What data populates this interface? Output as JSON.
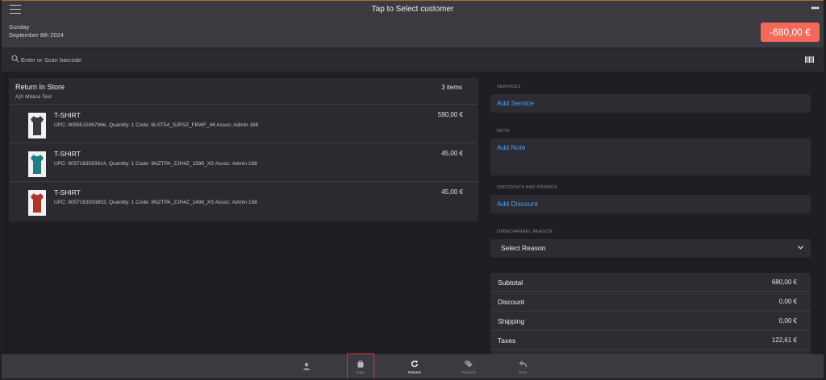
{
  "header": {
    "title": "Tap to Select customer",
    "day": "Sunday",
    "date": "September 8th 2024",
    "total": "-680,00 €"
  },
  "search": {
    "placeholder": "Enter or Scan barcode"
  },
  "cart": {
    "title": "Return In Store",
    "store": "A|X Milano Test",
    "count": "3 items",
    "items": [
      {
        "name": "T-SHIRT",
        "meta": "UPC: 8059515967966, Quantity: 1 Code: 6LST54_SJPSZ_FBWF_46 Assoc: Admin 168",
        "price": "590,00 €",
        "color": "#3a3a3e"
      },
      {
        "name": "T-SHIRT",
        "meta": "UPC: 8057163093914, Quantity: 1 Code: 8NZTPA_ZJH4Z_1588_XS Assoc: Admin 168",
        "price": "45,00 €",
        "color": "#1f7d86"
      },
      {
        "name": "T-SHIRT",
        "meta": "UPC: 8057163093853, Quantity: 1 Code: 8NZTPA_ZJH4Z_1498_XS Assoc: Admin 168",
        "price": "45,00 €",
        "color": "#b0362c"
      }
    ]
  },
  "services": {
    "label": "SERVICES",
    "action": "Add Service"
  },
  "note": {
    "label": "NOTE",
    "action": "Add Note"
  },
  "discounts": {
    "label": "DISCOUNTS AND PROMOS",
    "action": "Add Discount"
  },
  "omnichannel": {
    "label": "OMNICHANNEL REASON",
    "selected": "Select Reason"
  },
  "totals": [
    {
      "label": "Subtotal",
      "value": "680,00 €"
    },
    {
      "label": "Discount",
      "value": "0,00 €"
    },
    {
      "label": "Shipping",
      "value": "0,00 €"
    },
    {
      "label": "Taxes",
      "value": "122,61 €"
    }
  ],
  "nav": [
    {
      "label": "",
      "icon": "user-icon"
    },
    {
      "label": "Sales",
      "icon": "bag-icon"
    },
    {
      "label": "Returns",
      "icon": "refresh-icon"
    },
    {
      "label": "Products",
      "icon": "tag-icon"
    },
    {
      "label": "More",
      "icon": "reply-icon"
    }
  ],
  "colors": {
    "accent_link": "#4aa3f0",
    "total_badge": "#f36a5c",
    "highlight": "#e03030"
  }
}
